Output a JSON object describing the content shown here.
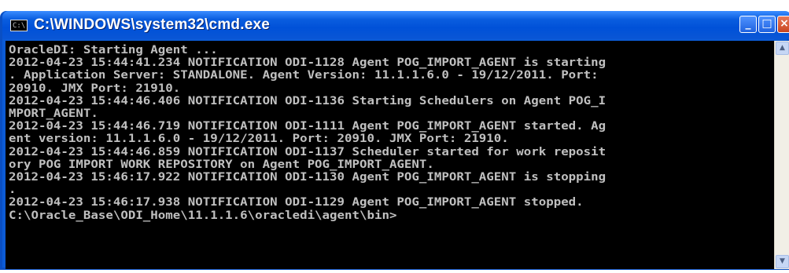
{
  "window": {
    "title": "C:\\WINDOWS\\system32\\cmd.exe",
    "app_icon_label": "C:\\",
    "controls": {
      "minimize": "_",
      "maximize": "□",
      "close": "×"
    }
  },
  "console": {
    "lines": [
      "OracleDI: Starting Agent ...",
      "2012-04-23 15:44:41.234 NOTIFICATION ODI-1128 Agent POG_IMPORT_AGENT is starting",
      ". Application Server: STANDALONE. Agent Version: 11.1.1.6.0 - 19/12/2011. Port:",
      "20910. JMX Port: 21910.",
      "2012-04-23 15:44:46.406 NOTIFICATION ODI-1136 Starting Schedulers on Agent POG_I",
      "MPORT_AGENT.",
      "2012-04-23 15:44:46.719 NOTIFICATION ODI-1111 Agent POG_IMPORT_AGENT started. Ag",
      "ent version: 11.1.1.6.0 - 19/12/2011. Port: 20910. JMX Port: 21910.",
      "2012-04-23 15:44:46.859 NOTIFICATION ODI-1137 Scheduler started for work reposit",
      "ory POG IMPORT WORK REPOSITORY on Agent POG_IMPORT_AGENT.",
      "2012-04-23 15:46:17.922 NOTIFICATION ODI-1130 Agent POG_IMPORT_AGENT is stopping",
      ".",
      "2012-04-23 15:46:17.938 NOTIFICATION ODI-1129 Agent POG_IMPORT_AGENT stopped.",
      "C:\\Oracle_Base\\ODI_Home\\11.1.1.6\\oracledi\\agent\\bin>"
    ]
  },
  "scrollbar": {
    "up_arrow": "▲",
    "down_arrow": "▼"
  },
  "colors": {
    "titlebar": "#0a5ddf",
    "console_bg": "#000000",
    "console_text": "#c0c0c0"
  }
}
